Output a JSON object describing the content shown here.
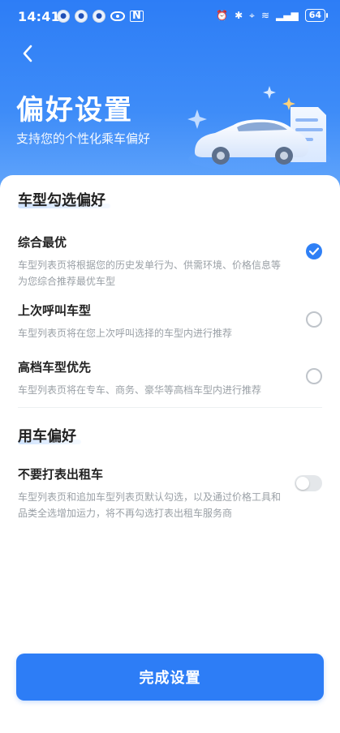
{
  "status_bar": {
    "time": "14:41",
    "battery": "64",
    "icons": [
      "app-icon",
      "app-icon",
      "app-icon",
      "eye-icon",
      "nfc-icon",
      "alarm-icon",
      "bluetooth-icon",
      "location-icon",
      "wifi-icon",
      "signal-icon",
      "battery-icon"
    ]
  },
  "header": {
    "title": "偏好设置",
    "subtitle": "支持您的个性化乘车偏好",
    "back_icon": "chevron-left-icon",
    "illustration": "car-illustration"
  },
  "section_car_type": {
    "title": "车型勾选偏好",
    "options": [
      {
        "title": "综合最优",
        "desc": "车型列表页将根据您的历史发单行为、供需环境、价格信息等为您综合推荐最优车型",
        "selected": true
      },
      {
        "title": "上次呼叫车型",
        "desc": "车型列表页将在您上次呼叫选择的车型内进行推荐",
        "selected": false
      },
      {
        "title": "高档车型优先",
        "desc": "车型列表页将在专车、商务、豪华等高档车型内进行推荐",
        "selected": false
      }
    ]
  },
  "section_usage": {
    "title": "用车偏好",
    "options": [
      {
        "title": "不要打表出租车",
        "desc": "车型列表页和追加车型列表页默认勾选，以及通过价格工具和品类全选增加运力，将不再勾选打表出租车服务商",
        "enabled": false
      }
    ]
  },
  "footer": {
    "button_label": "完成设置"
  },
  "colors": {
    "primary": "#2d7df6",
    "text": "#222222",
    "muted": "#9aa0a6",
    "radio_off": "#bfc4ca",
    "toggle_off": "#e4e7ea"
  }
}
